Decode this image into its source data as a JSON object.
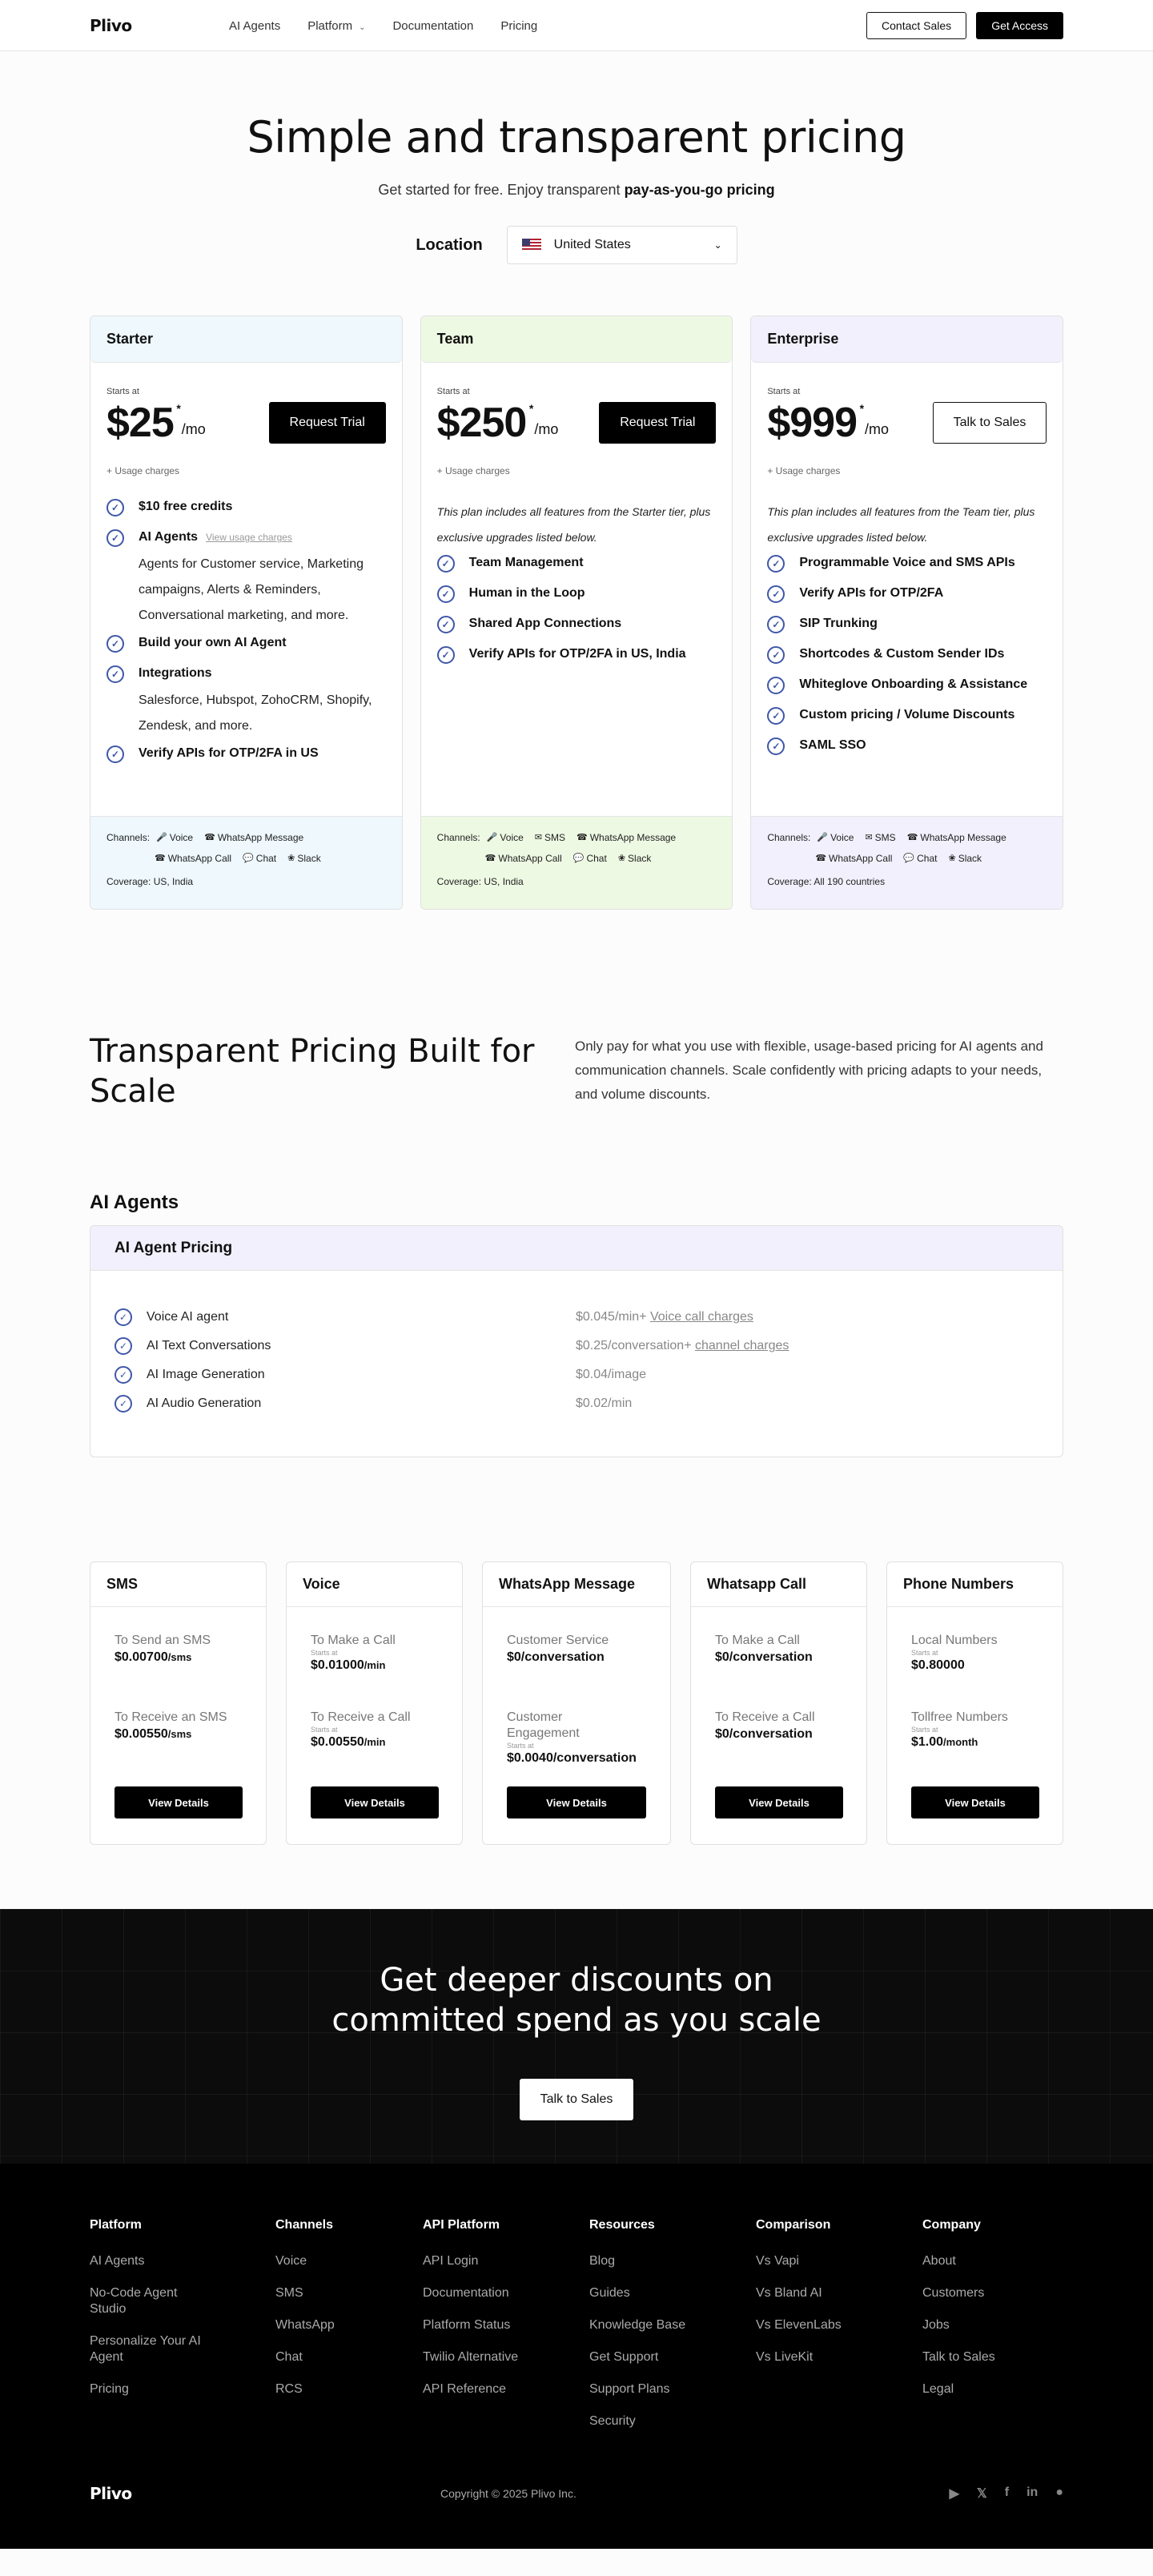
{
  "nav": {
    "logo": "Plivo",
    "links": [
      "AI Agents",
      "Platform",
      "Documentation",
      "Pricing"
    ],
    "contact": "Contact Sales",
    "access": "Get Access"
  },
  "hero": {
    "title": "Simple and transparent pricing",
    "sub_pre": "Get started for free. Enjoy transparent ",
    "sub_bold": "pay-as-you-go pricing",
    "loc_label": "Location",
    "loc_value": "United States"
  },
  "plans": [
    {
      "name": "Starter",
      "starts": "Starts at",
      "price": "$25",
      "ast": "*",
      "mo": "/mo",
      "btn": "Request Trial",
      "usage": "+ Usage charges",
      "f1": "$10 free credits",
      "f2": "AI Agents",
      "f2link": "View usage charges",
      "f2sub": "Agents for Customer service, Marketing campaigns, Alerts & Reminders, Conversational marketing, and more.",
      "f3": "Build your own AI Agent",
      "f4": "Integrations",
      "f4sub": "Salesforce, Hubspot, ZohoCRM, Shopify, Zendesk, and more.",
      "f5": "Verify APIs for OTP/2FA in US",
      "channels_label": "Channels:",
      "ch": [
        "Voice",
        "WhatsApp Message",
        "WhatsApp Call",
        "Chat",
        "Slack"
      ],
      "coverage": "Coverage: US, India"
    },
    {
      "name": "Team",
      "starts": "Starts at",
      "price": "$250",
      "ast": "*",
      "mo": "/mo",
      "btn": "Request Trial",
      "usage": "+ Usage charges",
      "desc": "This plan includes all features from the Starter tier, plus exclusive upgrades listed below.",
      "features": [
        "Team Management",
        "Human in the Loop",
        "Shared App Connections",
        "Verify APIs for OTP/2FA in US, India"
      ],
      "channels_label": "Channels:",
      "ch": [
        "Voice",
        "SMS",
        "WhatsApp Message",
        "WhatsApp Call",
        "Chat",
        "Slack"
      ],
      "coverage": "Coverage: US, India"
    },
    {
      "name": "Enterprise",
      "starts": "Starts at",
      "price": "$999",
      "ast": "*",
      "mo": "/mo",
      "btn": "Talk to Sales",
      "usage": "+ Usage charges",
      "desc": "This plan includes all features from the Team tier, plus exclusive upgrades listed below.",
      "features": [
        "Programmable Voice and SMS APIs",
        "Verify APIs for OTP/2FA",
        "SIP Trunking",
        "Shortcodes & Custom Sender IDs",
        "Whiteglove Onboarding & Assistance",
        "Custom pricing / Volume Discounts",
        "SAML SSO"
      ],
      "channels_label": "Channels:",
      "ch": [
        "Voice",
        "SMS",
        "WhatsApp Message",
        "WhatsApp Call",
        "Chat",
        "Slack"
      ],
      "coverage": "Coverage: All 190 countries"
    }
  ],
  "scale": {
    "title": "Transparent Pricing Built for Scale",
    "text": "Only pay for what you use with flexible, usage-based pricing for AI agents and communication channels. Scale confidently with pricing adapts to your needs, and volume discounts."
  },
  "ai": {
    "section": "AI Agents",
    "box_title": "AI Agent Pricing",
    "rows": [
      {
        "name": "Voice AI agent",
        "price": "$0.045/min+ ",
        "link": "Voice call charges"
      },
      {
        "name": "AI Text Conversations",
        "price": "$0.25/conversation+ ",
        "link": "channel charges"
      },
      {
        "name": "AI Image Generation",
        "price": "$0.04/image",
        "link": ""
      },
      {
        "name": "AI Audio Generation",
        "price": "$0.02/min",
        "link": ""
      }
    ]
  },
  "cards": [
    {
      "title": "SMS",
      "i1": "To Send an SMS",
      "s1": "",
      "v1": "$0.00700",
      "u1": "/sms",
      "i2": "To Receive an SMS",
      "s2": "",
      "v2": "$0.00550",
      "u2": "/sms",
      "btn": "View Details"
    },
    {
      "title": "Voice",
      "i1": "To Make a Call",
      "s1": "Starts at",
      "v1": "$0.01000",
      "u1": "/min",
      "i2": "To Receive a Call",
      "s2": "Starts at",
      "v2": "$0.00550",
      "u2": "/min",
      "btn": "View Details"
    },
    {
      "title": "WhatsApp Message",
      "i1": "Customer Service",
      "s1": "",
      "v1": "$0/conversation",
      "u1": "",
      "i2": "Customer Engagement",
      "s2": "Starts at",
      "v2": "$0.0040/conversation",
      "u2": "",
      "btn": "View Details"
    },
    {
      "title": "Whatsapp Call",
      "i1": "To Make a Call",
      "s1": "",
      "v1": "$0/conversation",
      "u1": "",
      "i2": "To Receive a Call",
      "s2": "",
      "v2": "$0/conversation",
      "u2": "",
      "btn": "View Details"
    },
    {
      "title": "Phone Numbers",
      "i1": "Local Numbers",
      "s1": "Starts at",
      "v1": "$0.80000",
      "u1": "",
      "i2": "Tollfree Numbers",
      "s2": "Starts at",
      "v2": "$1.00",
      "u2": "/month",
      "btn": "View Details"
    }
  ],
  "discount": {
    "line1": "Get deeper discounts on",
    "line2": "committed spend as you scale",
    "btn": "Talk to Sales"
  },
  "footer": {
    "cols": [
      {
        "title": "Platform",
        "links": [
          "AI Agents",
          "No-Code Agent Studio",
          "Personalize Your AI Agent",
          "Pricing"
        ]
      },
      {
        "title": "Channels",
        "links": [
          "Voice",
          "SMS",
          "WhatsApp",
          "Chat",
          "RCS"
        ]
      },
      {
        "title": "API Platform",
        "links": [
          "API Login",
          "Documentation",
          "Platform Status",
          "Twilio Alternative",
          "API Reference"
        ]
      },
      {
        "title": "Resources",
        "links": [
          "Blog",
          "Guides",
          "Knowledge Base",
          "Get Support",
          "Support Plans",
          "Security"
        ]
      },
      {
        "title": "Comparison",
        "links": [
          "Vs Vapi",
          "Vs Bland AI",
          "Vs ElevenLabs",
          "Vs LiveKit"
        ]
      },
      {
        "title": "Company",
        "links": [
          "About",
          "Customers",
          "Jobs",
          "Talk to Sales",
          "Legal"
        ]
      }
    ],
    "logo": "Plivo",
    "copyright": "Copyright © 2025 Plivo Inc.",
    "socials": [
      "youtube-icon",
      "x-icon",
      "facebook-icon",
      "linkedin-icon",
      "github-icon"
    ]
  }
}
